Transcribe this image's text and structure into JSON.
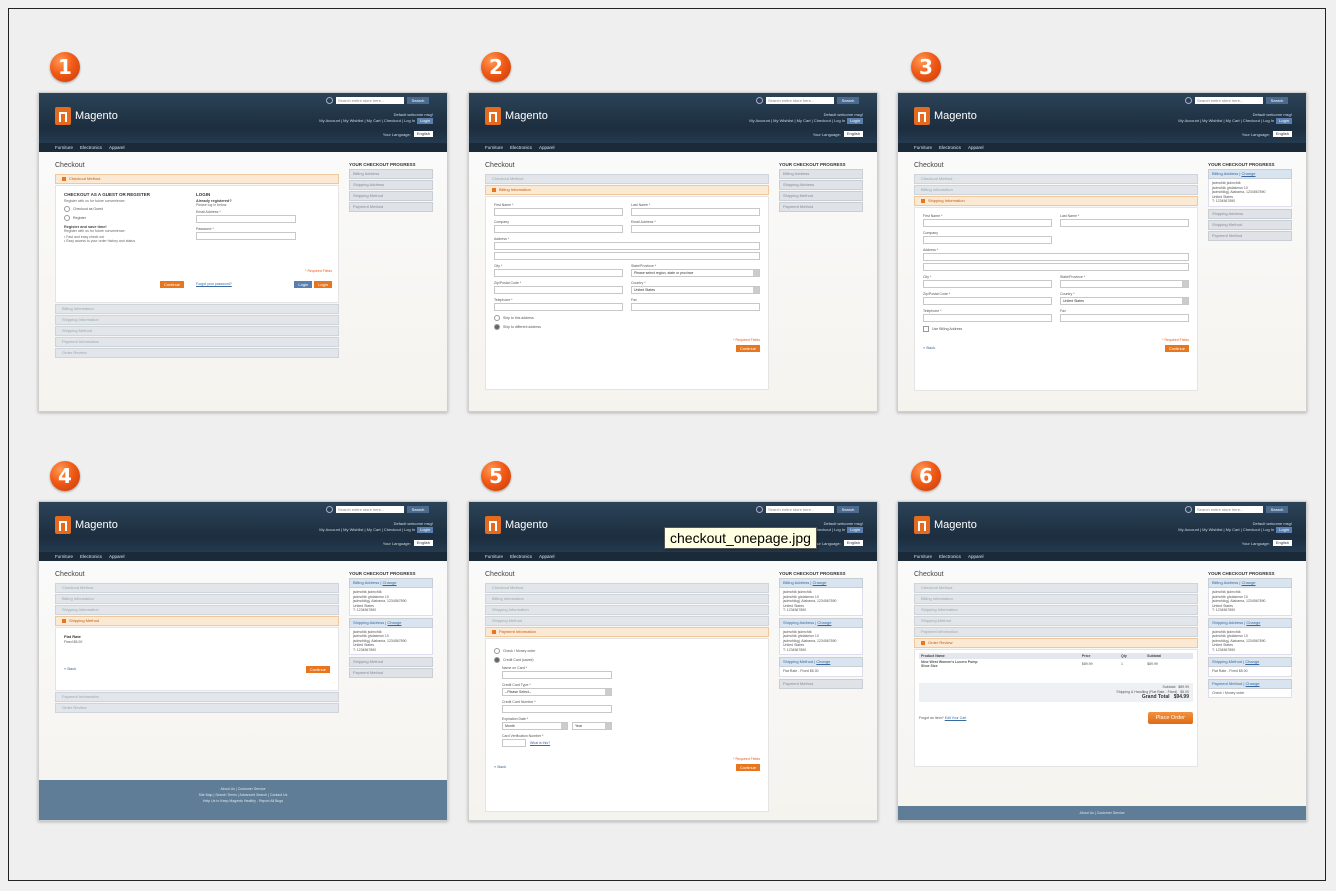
{
  "tooltip": "checkout_onepage.jpg",
  "steps": [
    "1",
    "2",
    "3",
    "4",
    "5",
    "6"
  ],
  "common": {
    "logo": "Magento",
    "search_placeholder": "Search entire store here...",
    "search_button": "Search",
    "welcome": "Default welcome msg!",
    "top_links": "My Account | My Wishlist | My Cart | Checkout | Log In",
    "login_label": "Login",
    "language_label": "Your Language:",
    "language_value": "English",
    "nav": [
      "Furniture",
      "Electronics",
      "Apparel"
    ],
    "page_title": "Checkout",
    "progress_title": "YOUR CHECKOUT PROGRESS",
    "progress_items": [
      "Billing Address",
      "Shipping Address",
      "Shipping Method",
      "Payment Method"
    ],
    "change": "Change",
    "continue": "Continue",
    "back": "Back",
    "required": "* Required Fields",
    "address_lines": [
      "jsdmcfdk jsdmcfdk",
      "jsdmcfdk ghdakmsn 10",
      "jsdmcfdkgj, Alabama, 1234567890",
      "United States",
      "T: 1234567890"
    ]
  },
  "sections": [
    "Checkout Method",
    "Billing Information",
    "Shipping Information",
    "Shipping Method",
    "Payment Information",
    "Order Review"
  ],
  "step1": {
    "heading": "CHECKOUT AS A GUEST OR REGISTER",
    "sub": "Register with us for future convenience:",
    "opt_guest": "Checkout as Guest",
    "opt_register": "Register",
    "reg_title": "Register and save time!",
    "reg_sub": "Register with us for future convenience:",
    "bullet1": "Fast and easy check out",
    "bullet2": "Easy access to your order history and status",
    "login_title": "LOGIN",
    "login_q": "Already registered?",
    "login_hint": "Please log in below:",
    "email_label": "Email Address *",
    "password_label": "Password *",
    "forgot": "Forgot your password?",
    "login_btn": "Login"
  },
  "form": {
    "first": "First Name *",
    "last": "Last Name *",
    "company": "Company",
    "email": "Email Address *",
    "address": "Address *",
    "city": "City *",
    "state": "State/Province *",
    "state_value": "Please select region, state or province",
    "zip": "Zip/Postal Code *",
    "country": "Country *",
    "country_value": "United States",
    "phone": "Telephone *",
    "fax": "Fax",
    "ship_same": "Ship to this address",
    "ship_diff": "Ship to different address",
    "use_billing": "Use Billing Address"
  },
  "step4": {
    "rate_title": "Flat Rate",
    "rate_value": "Fixed $5.00"
  },
  "step5": {
    "check": "Check / Money order",
    "cc": "Credit Card (saved)",
    "name_on_card": "Name on Card *",
    "cc_type": "Credit Card Type *",
    "cc_type_value": "--Please Select--",
    "cc_number": "Credit Card Number *",
    "exp": "Expiration Date *",
    "month": "Month",
    "year": "Year",
    "cvv": "Card Verification Number *",
    "what": "What is this?"
  },
  "step6": {
    "headers": [
      "Product Name",
      "Price",
      "Qty",
      "Subtotal"
    ],
    "product": "Nine West Women's Lucero Pump",
    "shoe_size": "Shoe Size",
    "price": "$89.99",
    "qty": "1",
    "subtotal": "$89.99",
    "subtotal_label": "Subtotal",
    "subtotal_value": "$89.99",
    "shipping_label": "Shipping & Handling (Flat Rate - Fixed)",
    "shipping_value": "$5.00",
    "grand_label": "Grand Total",
    "grand_value": "$94.99",
    "forgot": "Forgot an Item?",
    "edit_cart": "Edit Your Cart",
    "place": "Place Order",
    "ship_method": "Flat Rate - Fixed $5.00",
    "pay_method": "Check / Money order"
  },
  "footer": {
    "line1": "About Us | Customer Service",
    "line2": "Site Map | Search Terms | Advanced Search | Contact Us",
    "line3": "Help Us to Keep Magento Healthy - Report All Bugs"
  }
}
